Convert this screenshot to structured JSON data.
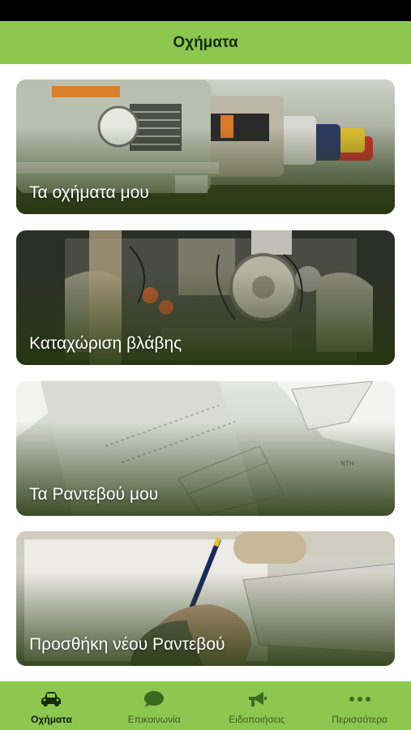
{
  "header": {
    "title": "Οχήματα"
  },
  "cards": [
    {
      "label": "Τα οχήματα μου"
    },
    {
      "label": "Καταχώριση βλάβης"
    },
    {
      "label": "Τα Ραντεβού μου"
    },
    {
      "label": "Προσθήκη νέου Ραντεβού"
    }
  ],
  "tabs": [
    {
      "label": "Οχήματα",
      "icon": "car-icon",
      "active": true
    },
    {
      "label": "Επικοινωνία",
      "icon": "chat-bubble-icon",
      "active": false
    },
    {
      "label": "Ειδοποιήσεις",
      "icon": "megaphone-icon",
      "active": false
    },
    {
      "label": "Περισσότερα",
      "icon": "more-dots-icon",
      "active": false
    }
  ],
  "colors": {
    "accent": "#8cc850",
    "active_icon": "#1a2a10",
    "inactive_icon": "#3a6a22",
    "status_bar": "#000000"
  }
}
